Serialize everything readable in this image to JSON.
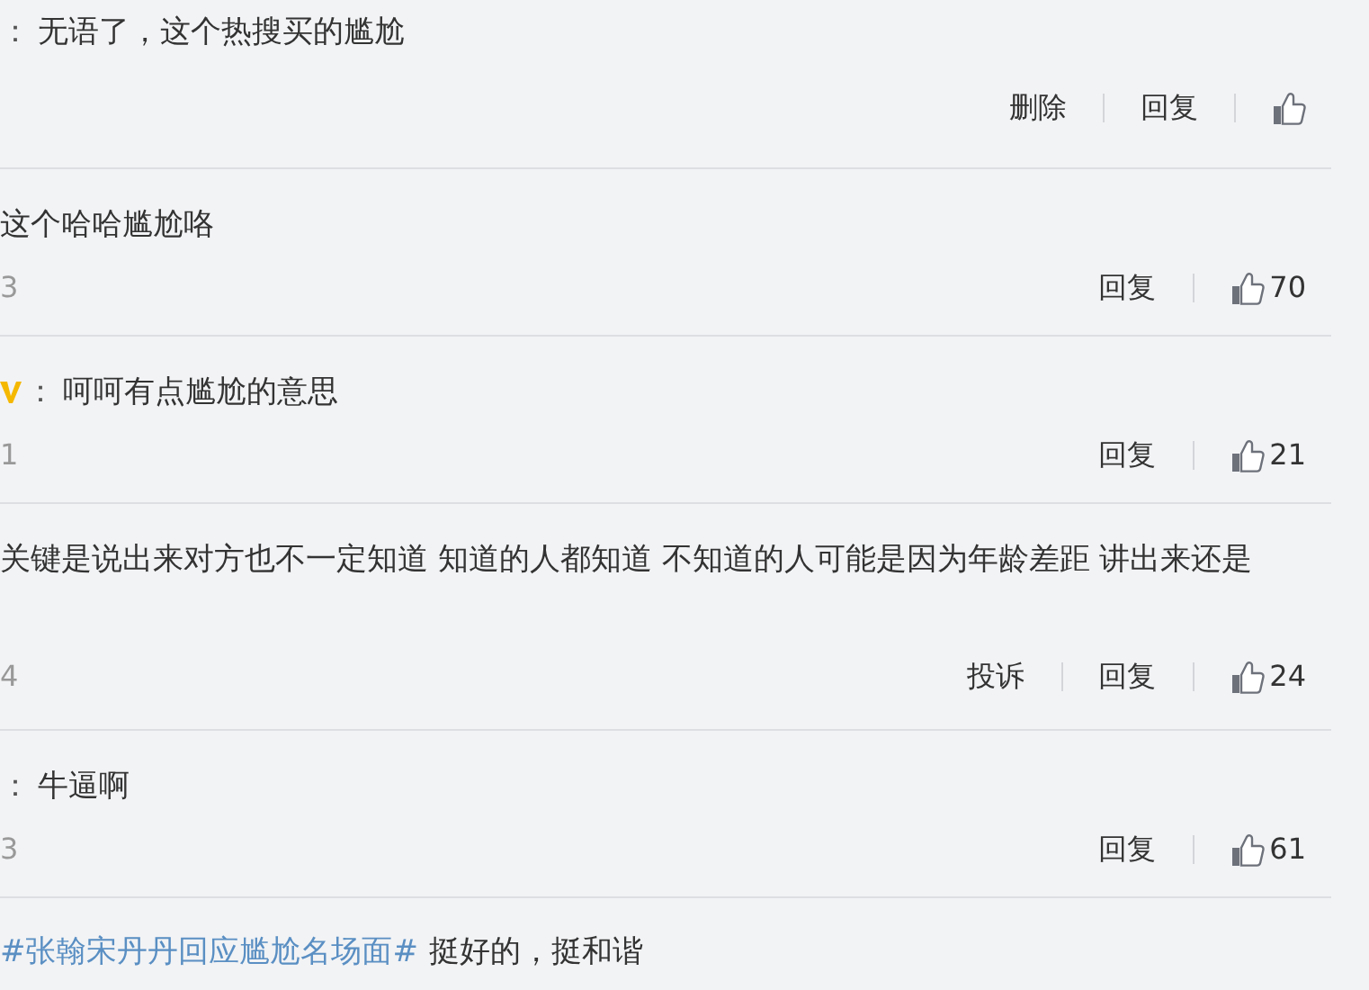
{
  "comments": [
    {
      "separator": "：",
      "text": "无语了，这个热搜买的尴尬",
      "actions": [
        "删除",
        "回复"
      ]
    },
    {
      "text": "这个哈哈尴尬咯",
      "meta": "3",
      "actions": [
        "回复"
      ],
      "likes": "70"
    },
    {
      "separator": "：",
      "verified": true,
      "text": "呵呵有点尴尬的意思",
      "meta": "1",
      "actions": [
        "回复"
      ],
      "likes": "21"
    },
    {
      "text": "关键是说出来对方也不一定知道 知道的人都知道 不知道的人可能是因为年龄差距 讲出来还是",
      "meta": "4",
      "actions": [
        "投诉",
        "回复"
      ],
      "likes": "24"
    },
    {
      "separator": "：",
      "text": "牛逼啊",
      "meta": "3",
      "actions": [
        "回复"
      ],
      "likes": "61"
    },
    {
      "hashtag": "#张翰宋丹丹回应尴尬名场面#",
      "text": "挺好的，挺和谐"
    }
  ]
}
